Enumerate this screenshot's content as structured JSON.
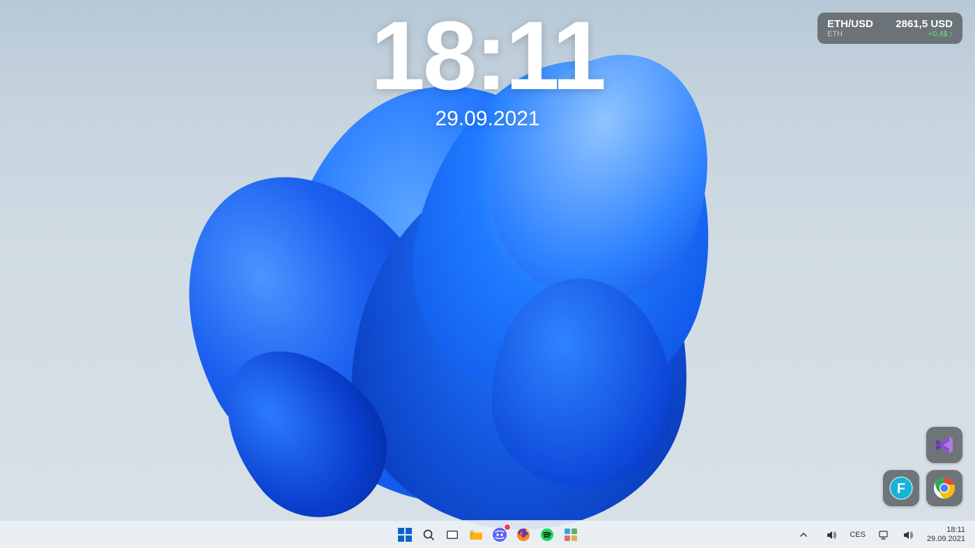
{
  "clock": {
    "time": "18:11",
    "date": "29.09.2021"
  },
  "crypto_widget": {
    "pair": "ETH/USD",
    "price": "2861,5 USD",
    "symbol": "ETH",
    "change": "+0,4$"
  },
  "desktop_tiles": {
    "visual_studio": "Visual Studio",
    "f_app": "F",
    "chrome": "Chrome"
  },
  "taskbar": {
    "items": [
      "start",
      "search",
      "task-view",
      "file-explorer",
      "discord",
      "firefox",
      "spotify",
      "widgets"
    ]
  },
  "systray": {
    "chevron": "chevron-up",
    "lang": "CES",
    "time": "18:11",
    "date": "29.09.2021"
  }
}
